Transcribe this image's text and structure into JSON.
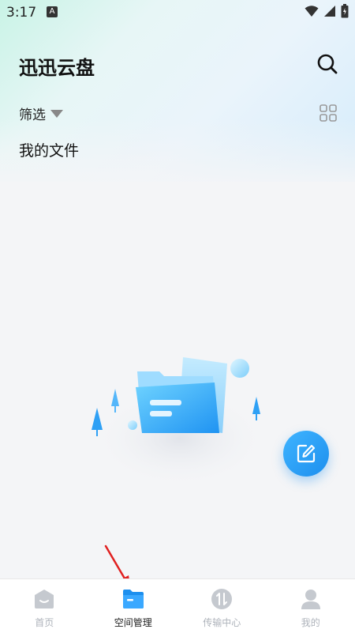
{
  "status_bar": {
    "time": "3:17",
    "notification_badge": "A"
  },
  "header": {
    "title": "迅迅云盘"
  },
  "toolbar": {
    "filter_label": "筛选"
  },
  "section": {
    "title": "我的文件"
  },
  "bottom_nav": {
    "items": [
      {
        "label": "首页",
        "icon": "home-icon",
        "active": false
      },
      {
        "label": "空间管理",
        "icon": "folder-icon",
        "active": true
      },
      {
        "label": "传输中心",
        "icon": "transfer-icon",
        "active": false
      },
      {
        "label": "我的",
        "icon": "profile-icon",
        "active": false
      }
    ]
  },
  "colors": {
    "accent": "#1d8fee",
    "inactive": "#aeb3bb",
    "annotation_arrow": "#e02020"
  }
}
